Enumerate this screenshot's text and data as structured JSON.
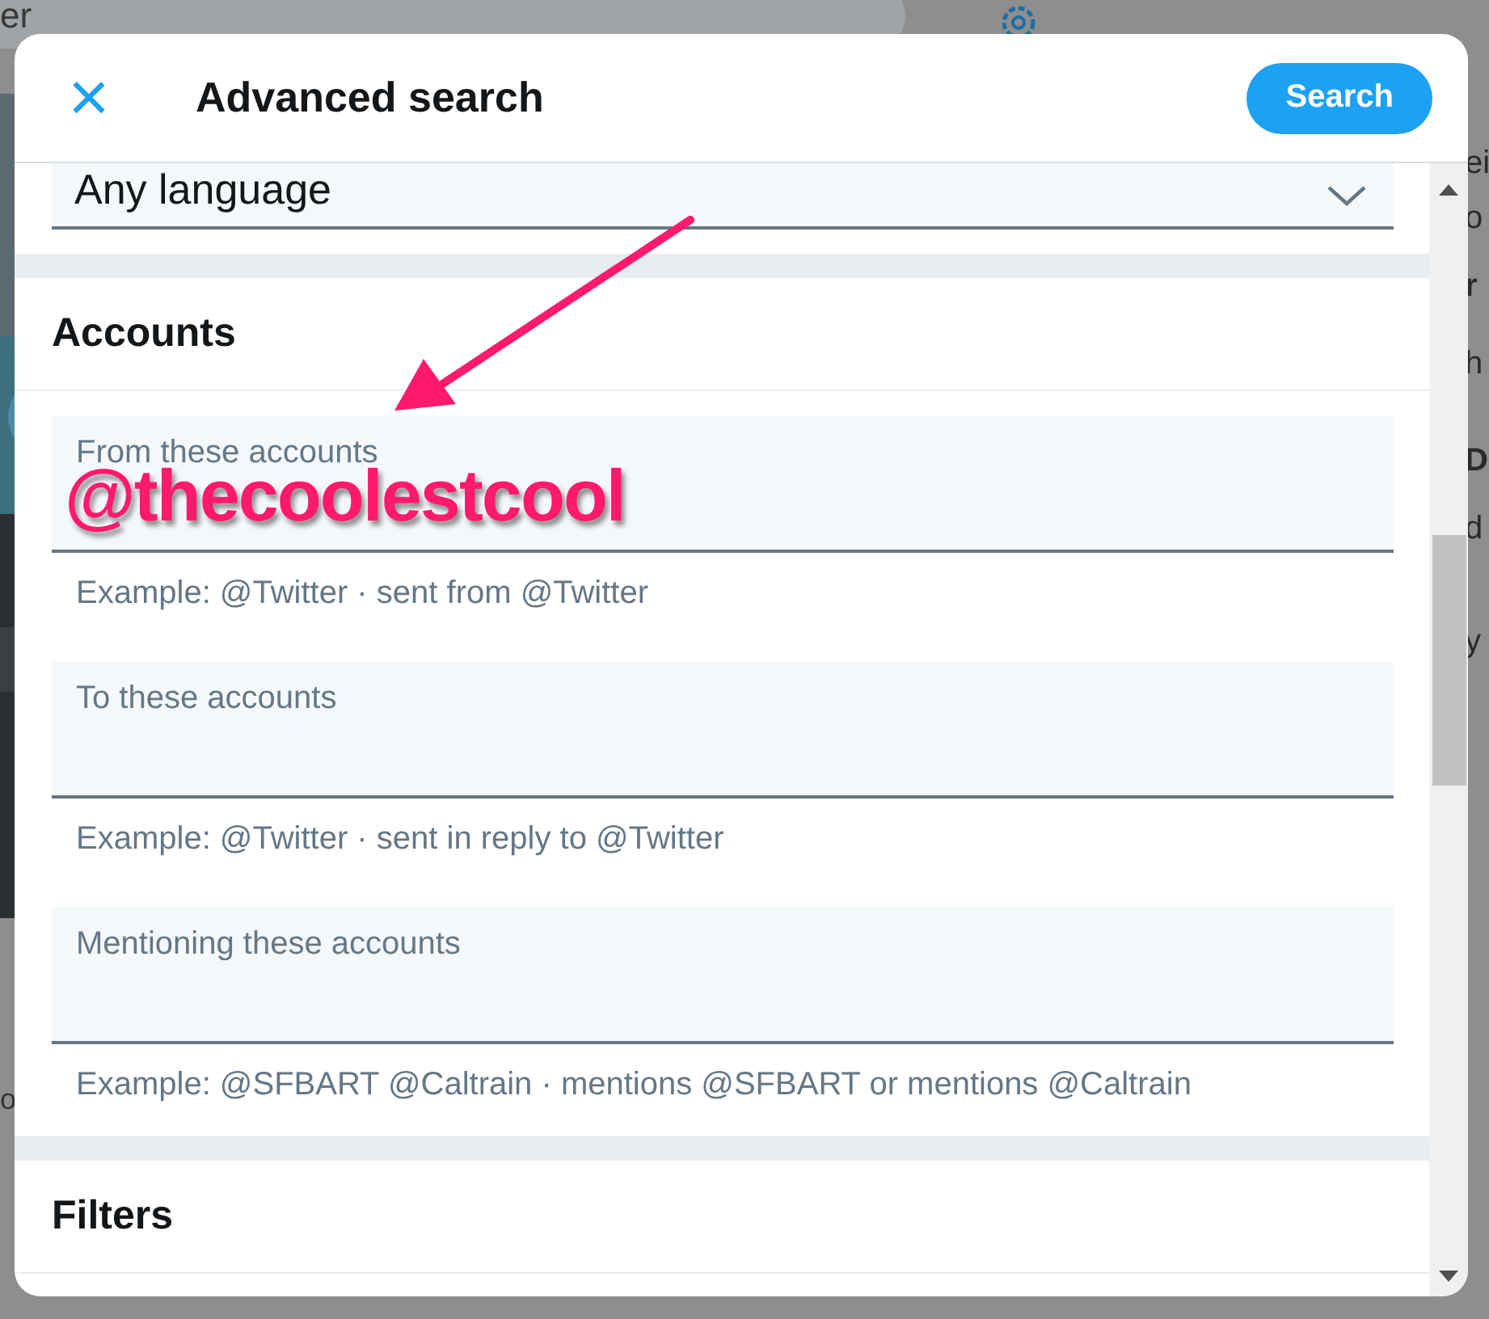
{
  "background": {
    "search_text": "er",
    "side_fragments": [
      "ei",
      "o",
      "r",
      "h",
      "D",
      "d",
      "y"
    ],
    "left_fragment": "o"
  },
  "dialog": {
    "close_icon": "×",
    "title": "Advanced search",
    "search_button": "Search"
  },
  "language_select": {
    "value": "Any language"
  },
  "accounts": {
    "heading": "Accounts",
    "fields": [
      {
        "placeholder": "From these accounts",
        "hint": "Example: @Twitter · sent from @Twitter"
      },
      {
        "placeholder": "To these accounts",
        "hint": "Example: @Twitter · sent in reply to @Twitter"
      },
      {
        "placeholder": "Mentioning these accounts",
        "hint": "Example: @SFBART @Caltrain · mentions @SFBART or mentions @Caltrain"
      }
    ]
  },
  "filters": {
    "heading": "Filters"
  },
  "annotation": {
    "text": "@thecoolestcool"
  }
}
